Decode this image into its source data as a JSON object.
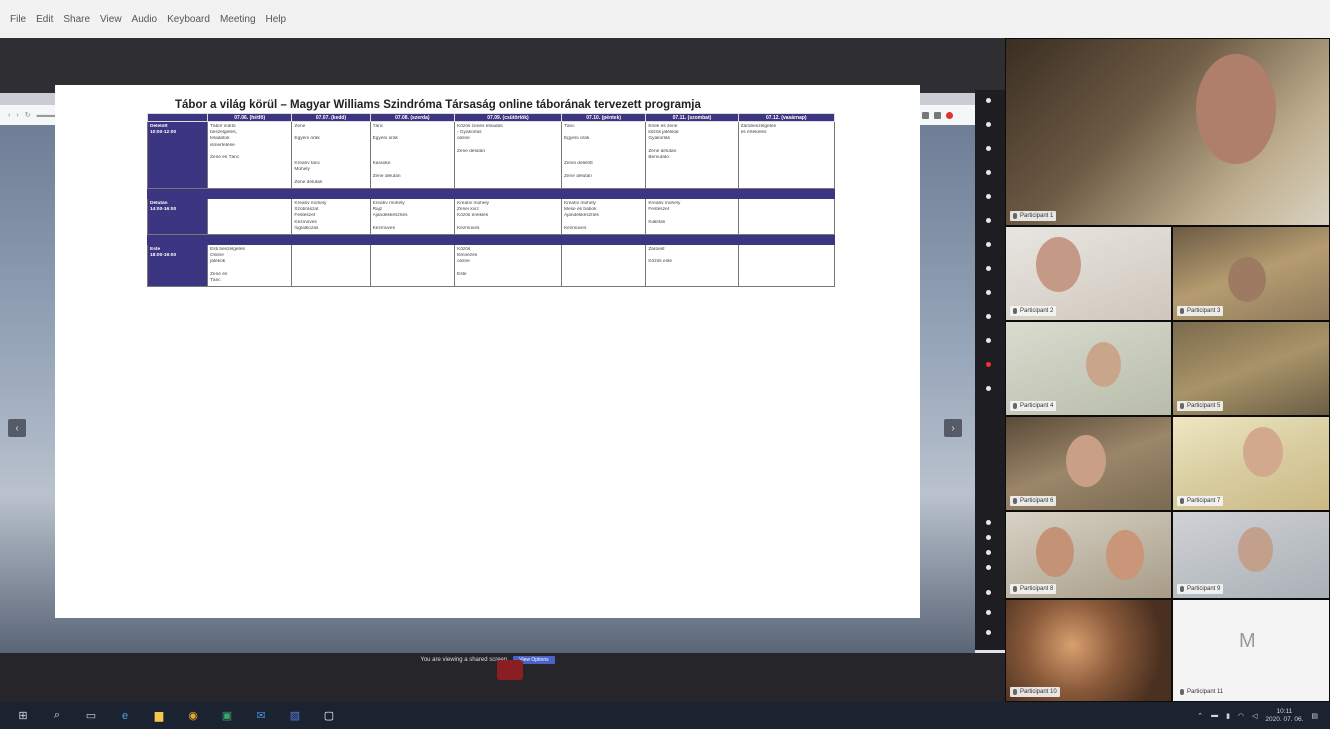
{
  "menubar": {
    "items": [
      "File",
      "Edit",
      "Share",
      "View",
      "Audio",
      "Keyboard",
      "Meeting",
      "Help"
    ]
  },
  "slide": {
    "title": "Tábor a világ körül – Magyar Williams Szindróma Társaság online táborának tervezett programja",
    "columns": [
      "",
      "07.06. (hétfő)",
      "07.07. (kedd)",
      "07.08. (szerda)",
      "07.09. (csütörtök)",
      "07.10. (péntek)",
      "07.11. (szombat)",
      "07.12. (vasárnap)"
    ],
    "rows": [
      {
        "head": [
          "Délelőtt",
          "10:00-12:00"
        ],
        "cells": [
          [
            "Tábor indító",
            "beszélgetés,",
            "feladatok",
            "ismertetése",
            "",
            "Zene és Tánc"
          ],
          [
            "Zene",
            "",
            "Egyéni órák",
            "",
            "",
            "",
            "Kreatív tánc",
            "Műhely",
            "",
            "Zene délután"
          ],
          [
            "Tánc",
            "",
            "Egyéni órák",
            "",
            "",
            "",
            "Karaoke",
            "",
            "Zene délután"
          ],
          [
            "Közös zenés előadás",
            "- Gyakorlás",
            "online",
            "",
            "Zene délután"
          ],
          [
            "Tánc",
            "",
            "Egyéni órák",
            "",
            "",
            "",
            "Zenei délelőtt",
            "",
            "Zene délután"
          ],
          [
            "Ének és zene",
            "közös játékkal",
            "Gyakorlás",
            "",
            "Zene délután",
            "Bemutató"
          ],
          [
            "Záróbeszélgetés",
            "és értékelés"
          ]
        ]
      },
      {
        "head": [
          "Délután",
          "14:00-16:00"
        ],
        "cells": [
          [
            ""
          ],
          [
            "Kreatív műhely",
            "Szobrászat",
            "Festészet",
            "Kézműves",
            "foglalkozás"
          ],
          [
            "Kreatív műhely",
            "Rajz",
            "Ajándékkészítés",
            "",
            "Kézműves"
          ],
          [
            "Kreatív műhely",
            "Zenei kvíz",
            "Közös éneklés",
            "",
            "Kézműves"
          ],
          [
            "Kreatív műhely",
            "Mese és bábok",
            "Ajándékkészítés",
            "",
            "Kézműves"
          ],
          [
            "Kreatív műhely",
            "Festészet",
            "",
            "Kiállítás"
          ],
          [
            ""
          ]
        ]
      },
      {
        "head": [
          "Este",
          "18:00-19:00"
        ],
        "cells": [
          [
            "Esti beszélgetés",
            "Online",
            "játékok",
            "",
            "Zene és",
            "Tánc"
          ],
          [
            ""
          ],
          [
            ""
          ],
          [
            "Közös",
            "filmnézés",
            "online",
            "",
            "Este"
          ],
          [
            ""
          ],
          [
            "Záróest",
            "",
            "Közös este"
          ],
          [
            ""
          ]
        ]
      }
    ]
  },
  "share_notice": {
    "text": "You are viewing a shared screen",
    "button": "View Options"
  },
  "gallery": {
    "tiles": [
      {
        "name": "Participant 1"
      },
      {
        "name": "Participant 2"
      },
      {
        "name": "Participant 3"
      },
      {
        "name": "Participant 4"
      },
      {
        "name": "Participant 5"
      },
      {
        "name": "Participant 6"
      },
      {
        "name": "Participant 7"
      },
      {
        "name": "Participant 8"
      },
      {
        "name": "Participant 9"
      },
      {
        "name": "Participant 10"
      },
      {
        "name": "Participant 11"
      },
      {
        "name": "M"
      }
    ]
  },
  "taskbar": {
    "apps": [
      "start-icon",
      "search-icon",
      "task-view-icon",
      "edge-icon",
      "explorer-icon",
      "chrome-icon",
      "store-icon",
      "mail-icon",
      "photos-icon",
      "zoom-icon"
    ],
    "clock_time": "10:11",
    "clock_date": "2020. 07. 06."
  },
  "colors": {
    "table_header": "#3b3582",
    "taskbar": "#1b2230",
    "share_button": "#4a63c9"
  }
}
